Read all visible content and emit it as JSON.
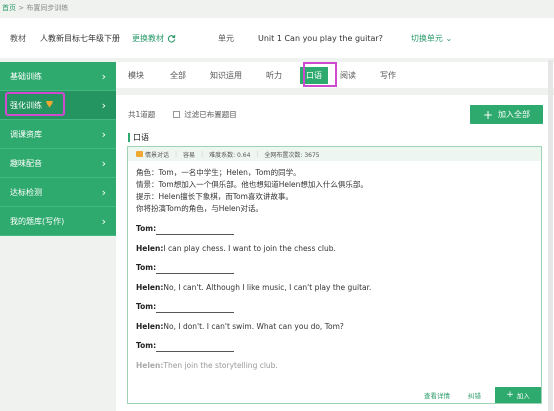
{
  "breadcrumb": {
    "home": "首页",
    "sep": ">",
    "current": "布置同步训练"
  },
  "topbar": {
    "material_label": "教材",
    "material_value": "人教新目标七年级下册",
    "change_material": "更换教材",
    "unit_label": "单元",
    "unit_value": "Unit 1 Can you play the guitar?",
    "switch_unit": "切换单元"
  },
  "sidebar": {
    "items": [
      {
        "label": "基础训练"
      },
      {
        "label": "强化训练"
      },
      {
        "label": "调课资库"
      },
      {
        "label": "趣味配音"
      },
      {
        "label": "达标检测"
      },
      {
        "label": "我的题库(写作)"
      }
    ]
  },
  "tabs": {
    "title": "模块",
    "items": [
      "全部",
      "知识运用",
      "听力",
      "口语",
      "阅读",
      "写作"
    ],
    "active": "口语"
  },
  "list": {
    "count_text": "共1道题",
    "filter_label": "过滤已布置题目",
    "add_all": "加入全部",
    "section_title": "口语"
  },
  "card": {
    "meta": {
      "type": "情景对话",
      "difficulty": "容易",
      "coefficient": "难度系数: 0.64",
      "assigned": "全网布置次数: 3675"
    },
    "instructions": [
      "角色：Tom，一名中学生；Helen，Tom的同学。",
      "情景：Tom想加入一个俱乐部。他也想知道Helen想加入什么俱乐部。",
      "提示：Helen擅长下象棋，而Tom喜欢讲故事。",
      "你将扮演Tom的角色，与Helen对话。"
    ],
    "dialogue": [
      {
        "speaker": "Tom:",
        "text": ""
      },
      {
        "speaker": "Helen:",
        "text": "I can play chess. I want to join the chess club."
      },
      {
        "speaker": "Tom:",
        "text": ""
      },
      {
        "speaker": "Helen:",
        "text": "No, I can't. Although I like music, I can't play the guitar."
      },
      {
        "speaker": "Tom:",
        "text": ""
      },
      {
        "speaker": "Helen:",
        "text": "No, I don't. I can't swim. What can you do, Tom?"
      },
      {
        "speaker": "Tom:",
        "text": ""
      },
      {
        "speaker": "Helen:",
        "text": "Then join the storytelling club."
      }
    ],
    "footer": {
      "detail": "查看详情",
      "error": "纠错",
      "add": "加入"
    }
  },
  "colors": {
    "accent": "#2faa6e",
    "highlight": "#d04ad0",
    "badge": "#f0a830"
  }
}
